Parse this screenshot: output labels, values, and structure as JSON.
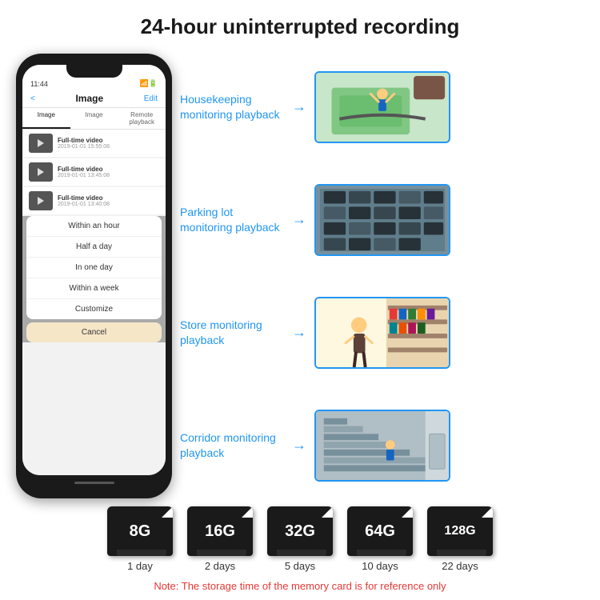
{
  "title": "24-hour uninterrupted recording",
  "phone": {
    "time": "11:44",
    "header_title": "Image",
    "header_left": "<",
    "header_right": "Edit",
    "tabs": [
      "Image",
      "Image",
      "Remote playback"
    ],
    "videos": [
      {
        "title": "Full-time video",
        "date": "2019-01-01 15:55:08"
      },
      {
        "title": "Full-time video",
        "date": "2019-01-01 13:45:08"
      },
      {
        "title": "Full-time video",
        "date": "2019-01-01 13:40:08"
      }
    ],
    "dropdown_items": [
      "Within an hour",
      "Half a day",
      "In one day",
      "Within a week",
      "Customize"
    ],
    "cancel_label": "Cancel"
  },
  "monitoring": [
    {
      "label": "Housekeeping\nmonitoring playback",
      "scene": "housekeeping"
    },
    {
      "label": "Parking lot\nmonitoring playback",
      "scene": "parking"
    },
    {
      "label": "Store monitoring\nplayback",
      "scene": "store"
    },
    {
      "label": "Corridor monitoring\nplayback",
      "scene": "corridor"
    }
  ],
  "storage": {
    "cards": [
      {
        "size": "8G",
        "days": "1 day"
      },
      {
        "size": "16G",
        "days": "2 days"
      },
      {
        "size": "32G",
        "days": "5 days"
      },
      {
        "size": "64G",
        "days": "10 days"
      },
      {
        "size": "128G",
        "days": "22 days"
      }
    ],
    "note": "Note: The storage time of the memory card is for reference only"
  }
}
